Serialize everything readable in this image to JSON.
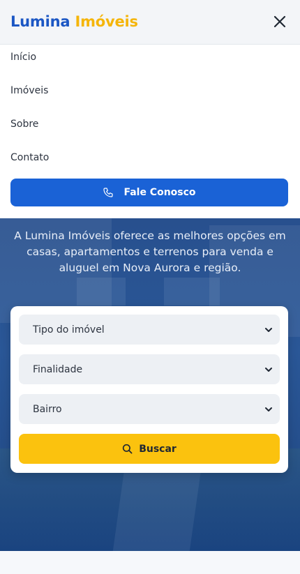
{
  "brand": {
    "name_part1": "Lumina",
    "name_part2": "Imóveis",
    "color_primary": "#1c57c4",
    "color_accent": "#f5b50a"
  },
  "header": {
    "close_icon": "close-icon"
  },
  "menu": {
    "items": [
      {
        "label": "Início"
      },
      {
        "label": "Imóveis"
      },
      {
        "label": "Sobre"
      },
      {
        "label": "Contato"
      }
    ],
    "cta": {
      "label": "Fale Conosco",
      "icon": "phone-icon",
      "color": "#1a62d6"
    }
  },
  "hero": {
    "description": "A Lumina Imóveis oferece as melhores opções em casas, apartamentos e terrenos para venda e aluguel em Nova Aurora e região."
  },
  "search": {
    "filters": [
      {
        "label": "Tipo do imóvel",
        "icon": "chevron-down-icon"
      },
      {
        "label": "Finalidade",
        "icon": "chevron-down-icon"
      },
      {
        "label": "Bairro",
        "icon": "chevron-down-icon"
      }
    ],
    "button": {
      "label": "Buscar",
      "icon": "search-icon",
      "color": "#fbc20e"
    }
  }
}
